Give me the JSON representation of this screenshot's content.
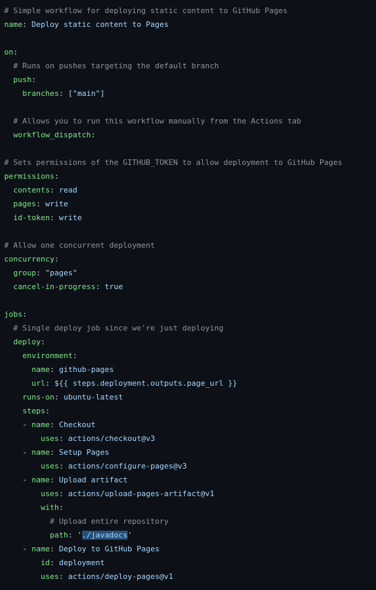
{
  "editor": {
    "language": "yaml",
    "selection": "./javadocs",
    "lines": [
      {
        "indent": 0,
        "comment": "# Simple workflow for deploying static content to GitHub Pages"
      },
      {
        "indent": 0,
        "key": "name",
        "value": "Deploy static content to Pages"
      },
      {
        "indent": 0
      },
      {
        "indent": 0,
        "key": "on"
      },
      {
        "indent": 1,
        "comment": "# Runs on pushes targeting the default branch"
      },
      {
        "indent": 1,
        "key": "push"
      },
      {
        "indent": 2,
        "key": "branches",
        "value": "[\"main\"]"
      },
      {
        "indent": 0
      },
      {
        "indent": 1,
        "comment": "# Allows you to run this workflow manually from the Actions tab"
      },
      {
        "indent": 1,
        "key": "workflow_dispatch"
      },
      {
        "indent": 0
      },
      {
        "indent": 0,
        "comment": "# Sets permissions of the GITHUB_TOKEN to allow deployment to GitHub Pages"
      },
      {
        "indent": 0,
        "key": "permissions"
      },
      {
        "indent": 1,
        "key": "contents",
        "value": "read"
      },
      {
        "indent": 1,
        "key": "pages",
        "value": "write"
      },
      {
        "indent": 1,
        "key": "id-token",
        "value": "write"
      },
      {
        "indent": 0
      },
      {
        "indent": 0,
        "comment": "# Allow one concurrent deployment"
      },
      {
        "indent": 0,
        "key": "concurrency"
      },
      {
        "indent": 1,
        "key": "group",
        "value": "\"pages\""
      },
      {
        "indent": 1,
        "key": "cancel-in-progress",
        "value": "true"
      },
      {
        "indent": 0
      },
      {
        "indent": 0,
        "key": "jobs"
      },
      {
        "indent": 1,
        "comment": "# Single deploy job since we're just deploying"
      },
      {
        "indent": 1,
        "key": "deploy"
      },
      {
        "indent": 2,
        "key": "environment"
      },
      {
        "indent": 3,
        "key": "name",
        "value": "github-pages"
      },
      {
        "indent": 3,
        "key": "url",
        "value": "${{ steps.deployment.outputs.page_url }}"
      },
      {
        "indent": 2,
        "key": "runs-on",
        "value": "ubuntu-latest"
      },
      {
        "indent": 2,
        "key": "steps"
      },
      {
        "indent": 3,
        "dash": true,
        "key": "name",
        "value": "Checkout"
      },
      {
        "indent": 4,
        "key": "uses",
        "value": "actions/checkout@v3"
      },
      {
        "indent": 3,
        "dash": true,
        "key": "name",
        "value": "Setup Pages"
      },
      {
        "indent": 4,
        "key": "uses",
        "value": "actions/configure-pages@v3"
      },
      {
        "indent": 3,
        "dash": true,
        "key": "name",
        "value": "Upload artifact"
      },
      {
        "indent": 4,
        "key": "uses",
        "value": "actions/upload-pages-artifact@v1"
      },
      {
        "indent": 4,
        "key": "with"
      },
      {
        "indent": 5,
        "comment": "# Upload entire repository"
      },
      {
        "indent": 5,
        "key": "path",
        "value": "'./javadocs'",
        "highlight": "./javadocs"
      },
      {
        "indent": 3,
        "dash": true,
        "key": "name",
        "value": "Deploy to GitHub Pages"
      },
      {
        "indent": 4,
        "key": "id",
        "value": "deployment"
      },
      {
        "indent": 4,
        "key": "uses",
        "value": "actions/deploy-pages@v1"
      }
    ]
  }
}
